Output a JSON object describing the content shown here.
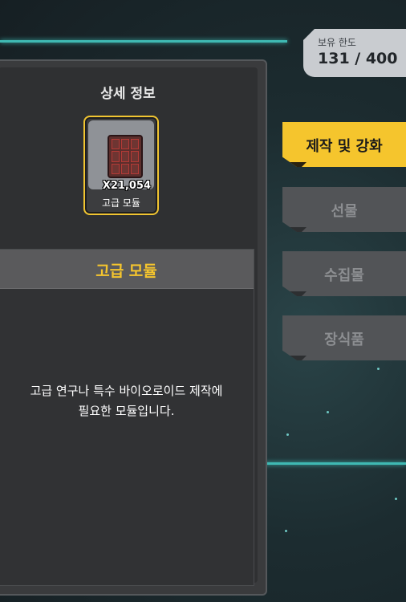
{
  "capacity": {
    "label": "보유 한도",
    "value": "131 / 400"
  },
  "detail": {
    "title": "상세 정보"
  },
  "item": {
    "name": "고급 모듈",
    "quantity": "X21,054",
    "description": "고급 연구나 특수 바이오로이드 제작에\n필요한 모듈입니다."
  },
  "tabs": [
    {
      "label": "제작 및 강화",
      "active": true
    },
    {
      "label": "선물",
      "active": false
    },
    {
      "label": "수집물",
      "active": false
    },
    {
      "label": "장식품",
      "active": false
    }
  ],
  "colors": {
    "accent": "#f5c52d",
    "cyan_line": "#3fb9b3"
  }
}
